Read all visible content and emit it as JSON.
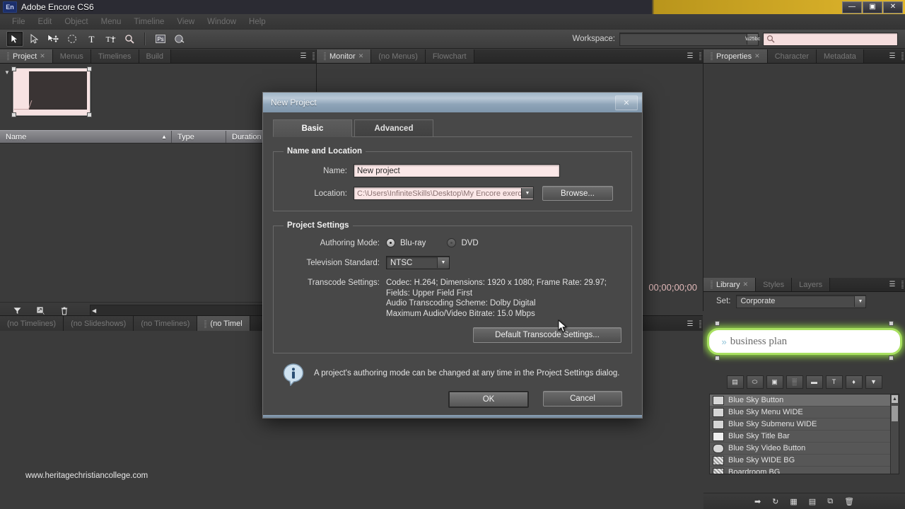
{
  "window": {
    "app_badge": "En",
    "title": "Adobe Encore CS6",
    "minimize": "—",
    "maximize": "▣",
    "close": "✕"
  },
  "menubar": {
    "items": [
      "File",
      "Edit",
      "Object",
      "Menu",
      "Timeline",
      "View",
      "Window",
      "Help"
    ]
  },
  "toolbar": {
    "tools": [
      {
        "name": "selection-tool",
        "title": "Selection"
      },
      {
        "name": "direct-select-tool",
        "title": "Direct Select"
      },
      {
        "name": "move-tool",
        "title": "Move"
      },
      {
        "name": "rotate-tool",
        "title": "Rotate"
      },
      {
        "name": "text-tool",
        "title": "Text"
      },
      {
        "name": "vertical-text-tool",
        "title": "Vertical Text"
      },
      {
        "name": "zoom-tool",
        "title": "Zoom"
      },
      {
        "name": "photoshop-tool",
        "title": "Edit in Photoshop"
      },
      {
        "name": "preview-tool",
        "title": "Preview"
      }
    ],
    "workspace_label": "Workspace:",
    "workspace_value": "",
    "search_placeholder": "",
    "search_value": ""
  },
  "project_panel": {
    "tabs": [
      {
        "label": "Project",
        "active": true,
        "closable": true
      },
      {
        "label": "Menus",
        "active": false,
        "closable": false
      },
      {
        "label": "Timelines",
        "active": false,
        "closable": false
      },
      {
        "label": "Build",
        "active": false,
        "closable": false
      }
    ],
    "columns": [
      "Name",
      "Type",
      "Duration"
    ],
    "sort_indicator": "▲",
    "rows": []
  },
  "monitor_panel": {
    "tabs": [
      {
        "label": "Monitor",
        "active": true,
        "closable": true
      },
      {
        "label": "(no Menus)",
        "active": false,
        "closable": false
      },
      {
        "label": "Flowchart",
        "active": false,
        "closable": false
      }
    ],
    "timecode": "00;00;00;00"
  },
  "properties_panel": {
    "tabs": [
      {
        "label": "Properties",
        "active": true,
        "closable": true
      },
      {
        "label": "Character",
        "active": false,
        "closable": false
      },
      {
        "label": "Metadata",
        "active": false,
        "closable": false
      }
    ]
  },
  "library_panel": {
    "tabs": [
      {
        "label": "Library",
        "active": true,
        "closable": true
      },
      {
        "label": "Styles",
        "active": false,
        "closable": false
      },
      {
        "label": "Layers",
        "active": false,
        "closable": false
      }
    ],
    "set_label": "Set:",
    "set_value": "Corporate",
    "preview_text": "business plan",
    "preview_chevrons": "»",
    "filters": [
      {
        "name": "filter-menus-icon",
        "glyph": "▤"
      },
      {
        "name": "filter-buttons-icon",
        "glyph": "⬭"
      },
      {
        "name": "filter-images-icon",
        "glyph": "▣"
      },
      {
        "name": "filter-backgrounds-icon",
        "glyph": "░"
      },
      {
        "name": "filter-layersets-icon",
        "glyph": "▬"
      },
      {
        "name": "filter-text-icon",
        "glyph": "T"
      },
      {
        "name": "filter-shapes-icon",
        "glyph": "♦"
      },
      {
        "name": "filter-replacement-icon",
        "glyph": "▼"
      }
    ],
    "items": [
      {
        "label": "Blue Sky Button",
        "icon": "button-asset-icon",
        "selected": true
      },
      {
        "label": "Blue Sky Menu WIDE",
        "icon": "menu-asset-icon",
        "selected": false
      },
      {
        "label": "Blue Sky Submenu WIDE",
        "icon": "submenu-asset-icon",
        "selected": false
      },
      {
        "label": "Blue Sky Title Bar",
        "icon": "titlebar-asset-icon",
        "selected": false
      },
      {
        "label": "Blue Sky Video Button",
        "icon": "video-button-asset-icon",
        "selected": false
      },
      {
        "label": "Blue Sky WIDE BG",
        "icon": "background-asset-icon",
        "selected": false
      },
      {
        "label": "Boardroom BG",
        "icon": "background-asset-icon",
        "selected": false
      }
    ],
    "footer_buttons": [
      {
        "name": "place-button",
        "glyph": "➡"
      },
      {
        "name": "replace-button",
        "glyph": "↻"
      },
      {
        "name": "new-item-button",
        "glyph": "▦"
      },
      {
        "name": "new-menu-button",
        "glyph": "▤"
      },
      {
        "name": "duplicate-button",
        "glyph": "⧉"
      },
      {
        "name": "delete-button",
        "glyph": "🗑"
      }
    ],
    "scroll_up": "▲"
  },
  "bottom_strip": {
    "tabs": [
      {
        "label": "(no Timelines)",
        "active": false
      },
      {
        "label": "(no Slideshows)",
        "active": false
      },
      {
        "label": "(no Timelines)",
        "active": false
      },
      {
        "label": "(no Timel",
        "active": true
      }
    ]
  },
  "watermark": "www.heritagechristiancollege.com",
  "dialog": {
    "title": "New Project",
    "close_glyph": "✕",
    "tabs": [
      {
        "label": "Basic",
        "active": true
      },
      {
        "label": "Advanced",
        "active": false
      }
    ],
    "name_location": {
      "legend": "Name and Location",
      "name_label": "Name:",
      "name_value": "New project",
      "location_label": "Location:",
      "location_value": "C:\\Users\\InfiniteSkills\\Desktop\\My Encore exercise...",
      "browse_label": "Browse...",
      "dropdown_glyph": "▼"
    },
    "project_settings": {
      "legend": "Project Settings",
      "authoring_label": "Authoring Mode:",
      "authoring_options": [
        {
          "label": "Blu-ray",
          "selected": true
        },
        {
          "label": "DVD",
          "selected": false
        }
      ],
      "tv_standard_label": "Television Standard:",
      "tv_standard_value": "NTSC",
      "tv_standard_glyph": "▼",
      "transcode_label": "Transcode Settings:",
      "transcode_lines": [
        "Codec: H.264; Dimensions: 1920 x 1080; Frame Rate: 29.97;",
        "Fields: Upper Field First",
        "Audio Transcoding Scheme: Dolby Digital",
        "Maximum Audio/Video Bitrate: 15.0 Mbps"
      ],
      "transcode_button": "Default Transcode Settings..."
    },
    "note": "A project's authoring mode can be changed at any time in the Project Settings dialog.",
    "ok_label": "OK",
    "cancel_label": "Cancel"
  }
}
